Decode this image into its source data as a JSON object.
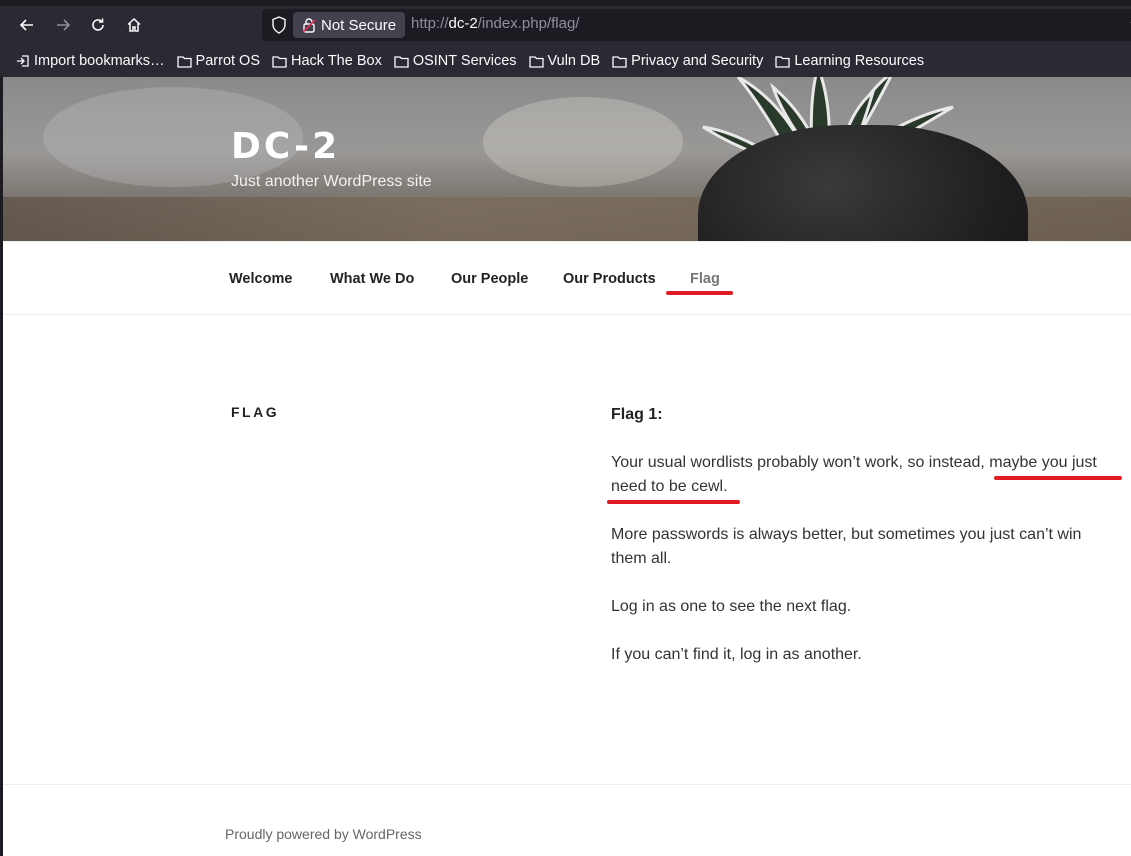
{
  "browser": {
    "security_label": "Not Secure",
    "url_prefix": "http://",
    "url_host": "dc-2",
    "url_path": "/index.php/flag/",
    "bookmarks": [
      {
        "label": "Import bookmarks…",
        "icon": "import-icon"
      },
      {
        "label": "Parrot OS",
        "icon": "folder-icon"
      },
      {
        "label": "Hack The Box",
        "icon": "folder-icon"
      },
      {
        "label": "OSINT Services",
        "icon": "folder-icon"
      },
      {
        "label": "Vuln DB",
        "icon": "folder-icon"
      },
      {
        "label": "Privacy and Security",
        "icon": "folder-icon"
      },
      {
        "label": "Learning Resources",
        "icon": "folder-icon"
      }
    ]
  },
  "site": {
    "title": "DC-2",
    "description": "Just another WordPress site"
  },
  "menu": {
    "items": [
      "Welcome",
      "What We Do",
      "Our People",
      "Our Products",
      "Flag"
    ],
    "current": "Flag"
  },
  "page": {
    "title": "FLAG",
    "flag_heading": "Flag 1:",
    "para1_part1": "Your usual wordlists probably won’t work, so instead, ",
    "para1_highlight": "maybe you just need to be cewl.",
    "para2": "More passwords is always better, but sometimes you just can’t win them all.",
    "para3": "Log in as one to see the next flag.",
    "para4": "If you can’t find it, log in as another."
  },
  "footer": {
    "text": "Proudly powered by WordPress"
  },
  "colors": {
    "annotation": "#e01b24",
    "chrome_bg": "#2b2a33",
    "urlbar_bg": "#1c1b22"
  }
}
